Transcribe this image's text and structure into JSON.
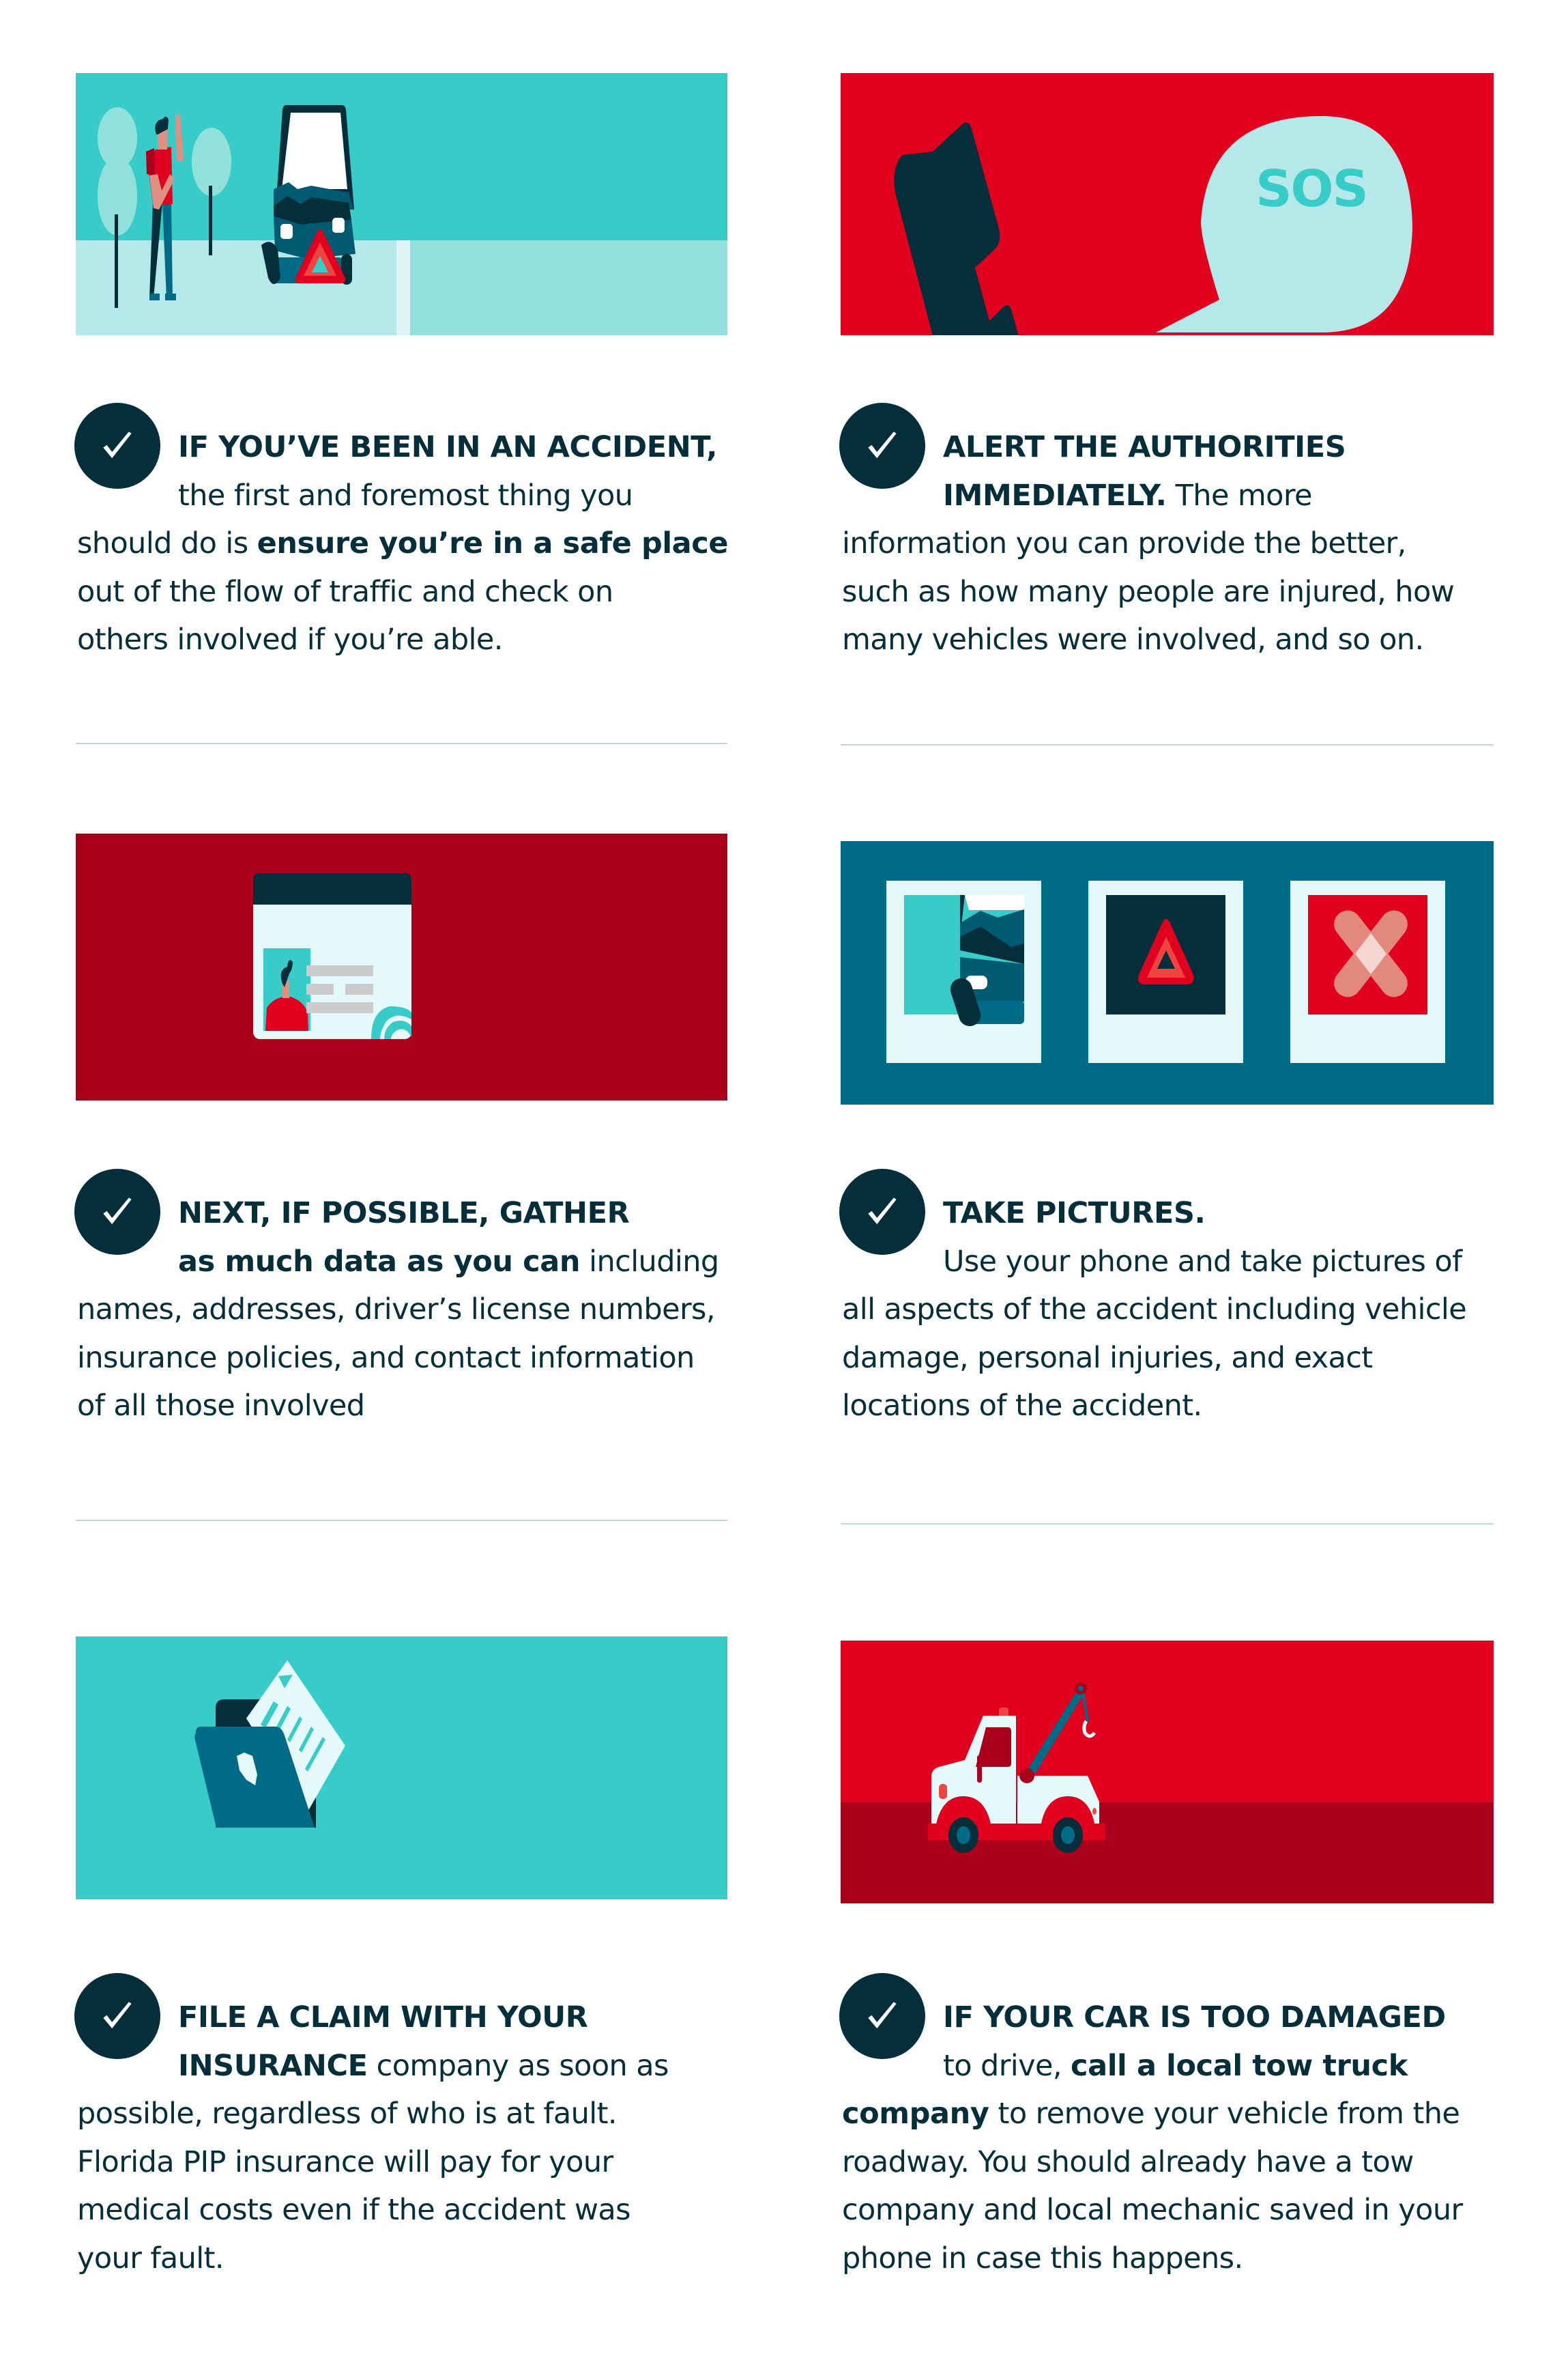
{
  "colors": {
    "teal": "#38CCC8",
    "pale_teal": "#B5E8E8",
    "navy": "#052E3B",
    "blue": "#006B87",
    "red": "#E2001F",
    "dark_red": "#AB001C",
    "card_white": "#E5F9FB",
    "divider": "#BCD9DE"
  },
  "steps": [
    {
      "id": "safe-place",
      "illustration": "person-and-crashed-car",
      "icon": "check-icon",
      "lines": [
        [
          {
            "t": "IF YOU’VE BEEN IN AN ACCIDENT,",
            "b": true
          }
        ],
        [
          {
            "t": "the first and foremost thing you",
            "b": false
          }
        ],
        [
          {
            "t": "should do is ",
            "b": false
          },
          {
            "t": "ensure you’re in a safe place",
            "b": true
          }
        ],
        [
          {
            "t": "out of the flow of traffic and check on",
            "b": false
          }
        ],
        [
          {
            "t": "others involved if you’re able.",
            "b": false
          }
        ]
      ]
    },
    {
      "id": "alert-authorities",
      "illustration": "phone-sos",
      "sos_label": "SOS",
      "icon": "check-icon",
      "lines": [
        [
          {
            "t": "ALERT THE AUTHORITIES",
            "b": true
          }
        ],
        [
          {
            "t": "IMMEDIATELY.",
            "b": true
          },
          {
            "t": " The more",
            "b": false
          }
        ],
        [
          {
            "t": "information you can provide the better,",
            "b": false
          }
        ],
        [
          {
            "t": "such as how many people are injured, how",
            "b": false
          }
        ],
        [
          {
            "t": "many vehicles were involved, and so on.",
            "b": false
          }
        ]
      ]
    },
    {
      "id": "gather-data",
      "illustration": "drivers-license",
      "icon": "check-icon",
      "lines": [
        [
          {
            "t": "NEXT, IF POSSIBLE, GATHER",
            "b": true
          }
        ],
        [
          {
            "t": "as much data as you can",
            "b": true
          },
          {
            "t": " including",
            "b": false
          }
        ],
        [
          {
            "t": "names, addresses, driver’s license numbers,",
            "b": false
          }
        ],
        [
          {
            "t": "insurance policies, and contact information",
            "b": false
          }
        ],
        [
          {
            "t": "of all those involved",
            "b": false
          }
        ]
      ]
    },
    {
      "id": "take-pictures",
      "illustration": "three-photos",
      "icon": "check-icon",
      "lines": [
        [
          {
            "t": "TAKE PICTURES.",
            "b": true
          }
        ],
        [
          {
            "t": "Use your phone and take pictures of",
            "b": false
          }
        ],
        [
          {
            "t": "all aspects of the accident including vehicle",
            "b": false
          }
        ],
        [
          {
            "t": "damage, personal injuries, and exact",
            "b": false
          }
        ],
        [
          {
            "t": "locations of the accident.",
            "b": false
          }
        ]
      ]
    },
    {
      "id": "file-claim",
      "illustration": "folder-document",
      "icon": "check-icon",
      "lines": [
        [
          {
            "t": "FILE A CLAIM WITH YOUR",
            "b": true
          }
        ],
        [
          {
            "t": "INSURANCE",
            "b": true
          },
          {
            "t": " company as soon as",
            "b": false
          }
        ],
        [
          {
            "t": "possible, regardless of who is at fault.",
            "b": false
          }
        ],
        [
          {
            "t": "Florida PIP insurance will pay for your",
            "b": false
          }
        ],
        [
          {
            "t": "medical costs even if the accident was",
            "b": false
          }
        ],
        [
          {
            "t": "your fault.",
            "b": false
          }
        ]
      ]
    },
    {
      "id": "tow-truck",
      "illustration": "tow-truck",
      "icon": "check-icon",
      "lines": [
        [
          {
            "t": "IF YOUR CAR IS TOO DAMAGED",
            "b": true
          }
        ],
        [
          {
            "t": "to drive, ",
            "b": false
          },
          {
            "t": "call a local tow truck",
            "b": true
          }
        ],
        [
          {
            "t": "company",
            "b": true
          },
          {
            "t": " to remove your vehicle from the",
            "b": false
          }
        ],
        [
          {
            "t": "roadway. You should already have a tow",
            "b": false
          }
        ],
        [
          {
            "t": "company and local mechanic saved in your",
            "b": false
          }
        ],
        [
          {
            "t": "phone in case this happens.",
            "b": false
          }
        ]
      ]
    }
  ]
}
